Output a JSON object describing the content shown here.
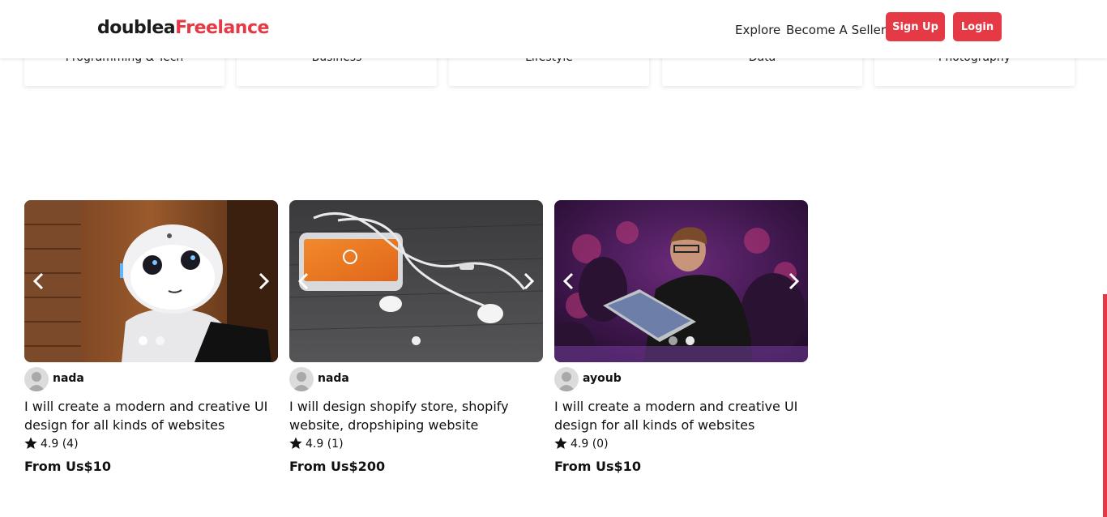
{
  "header": {
    "logo_part1": "doublea",
    "logo_part2": "Freelance",
    "nav": {
      "explore": "Explore",
      "become_seller": "Become A Seller"
    },
    "signup_label": "Sign Up",
    "login_label": "Login"
  },
  "categories": [
    "Programming & Tech",
    "Business",
    "Lifestyle",
    "Data",
    "Photography"
  ],
  "gigs": [
    {
      "seller": "nada",
      "title": "I will create a modern and creative UI design for all kinds of websites",
      "rating": "4.9",
      "reviews": "(4)",
      "price": "From Us$10"
    },
    {
      "seller": "nada",
      "title": "I will design shopify store, shopify website, dropshiping website",
      "rating": "4.9",
      "reviews": "(1)",
      "price": "From Us$200"
    },
    {
      "seller": "ayoub",
      "title": "I will create a modern and creative UI design for all kinds of websites",
      "rating": "4.9",
      "reviews": "(0)",
      "price": "From Us$10"
    }
  ],
  "colors": {
    "accent": "#e63946",
    "text": "#111111"
  }
}
